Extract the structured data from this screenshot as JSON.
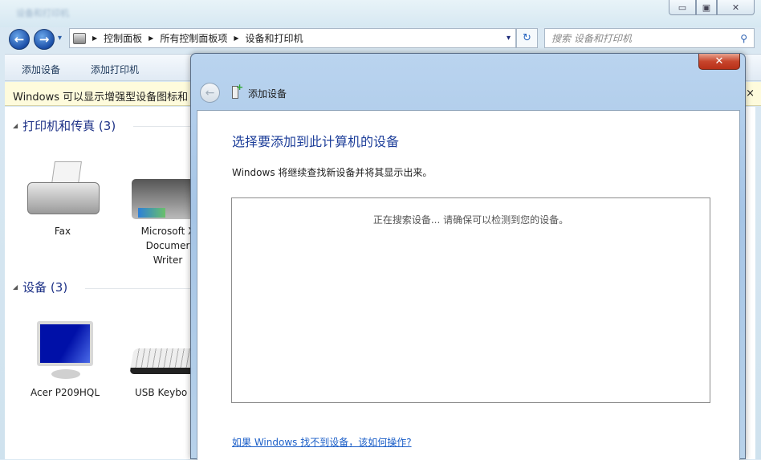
{
  "window": {
    "title_blurred": "设备和打印机",
    "controls": {
      "minimize": "▭",
      "maximize": "▣",
      "close": "✕"
    }
  },
  "nav": {
    "back": "←",
    "forward": "→",
    "dropdown": "▾"
  },
  "address": {
    "crumbs": [
      "控制面板",
      "所有控制面板项",
      "设备和打印机"
    ],
    "sep": "▶",
    "dropdown": "▾",
    "refresh": "↻"
  },
  "search": {
    "placeholder": "搜索 设备和打印机",
    "icon": "⚲"
  },
  "toolbar": {
    "add_device": "添加设备",
    "add_printer": "添加打印机"
  },
  "infobar": {
    "text": "Windows 可以显示增强型设备图标和",
    "close": "×"
  },
  "groups": [
    {
      "title": "打印机和传真 (3)",
      "items": [
        {
          "label": "Fax"
        },
        {
          "label": "Microsoft XPS Document Writer",
          "visible_label_lines": [
            "Microsoft X",
            "Documer",
            "Writer"
          ]
        }
      ]
    },
    {
      "title": "设备 (3)",
      "items": [
        {
          "label": "Acer P209HQL"
        },
        {
          "label": "USB Keybo"
        }
      ]
    }
  ],
  "dialog": {
    "title": "添加设备",
    "back": "←",
    "close": "✕",
    "heading": "选择要添加到此计算机的设备",
    "subtitle": "Windows 将继续查找新设备并将其显示出来。",
    "searching": "正在搜索设备... 请确保可以检测到您的设备。",
    "help_link": "如果 Windows 找不到设备，该如何操作?"
  }
}
